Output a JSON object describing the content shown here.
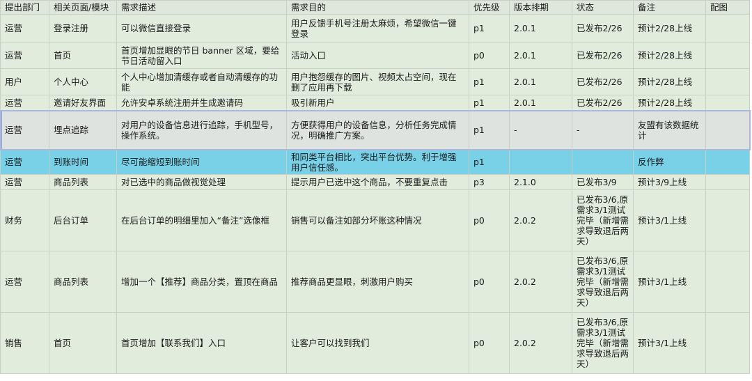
{
  "columns": [
    "提出部门",
    "相关页面/模块",
    "需求描述",
    "需求目的",
    "优先级",
    "版本排期",
    "状态",
    "备注",
    "配图"
  ],
  "rows": [
    {
      "dept": "运营",
      "page": "登录注册",
      "desc": "可以微信直接登录",
      "purpose": "用户反馈手机号注册太麻烦，希望微信一键登录",
      "priority": "p1",
      "version": "2.0.1",
      "status": "已发布2/26",
      "note": "预计2/28上线",
      "image": ""
    },
    {
      "dept": "运营",
      "page": "首页",
      "desc": "首页增加显眼的节日 banner 区域，要给节日活动留入口",
      "purpose": "活动入口",
      "priority": "p0",
      "version": "2.0.1",
      "status": "已发布2/26",
      "note": "预计2/28上线",
      "image": ""
    },
    {
      "dept": "用户",
      "page": "个人中心",
      "desc": " 个人中心增加清缓存或者自动清缓存的功能",
      "purpose": "用户抱怨缓存的图片、视频太占空间，现在删了应用再下载",
      "priority": "p1",
      "version": "2.0.1",
      "status": "已发布2/26",
      "note": "预计2/28上线",
      "image": ""
    },
    {
      "dept": "运营",
      "page": "邀请好友界面",
      "desc": "允许安卓系统注册并生成邀请码",
      "purpose": "吸引新用户",
      "priority": "p1",
      "version": "2.0.1",
      "status": "已发布2/26",
      "note": "预计2/28上线",
      "image": ""
    },
    {
      "dept": "运营",
      "page": "埋点追踪",
      "desc": "对用户的设备信息进行追踪，手机型号，操作系统。",
      "purpose": "方便获得用户的设备信息，分析任务完成情况，明确推广方案。",
      "priority": "p1",
      "version": "-",
      "status": "-",
      "note": "友盟有该数据统计",
      "image": ""
    },
    {
      "dept": "运营",
      "page": "到账时间",
      "desc": "尽可能缩短到账时间",
      "purpose": "和同类平台相比，突出平台优势。利于增强用户信任感。",
      "priority": "p1",
      "version": "",
      "status": "",
      "note": "反作弊",
      "image": ""
    },
    {
      "dept": "运营",
      "page": "商品列表",
      "desc": "对已选中的商品做视觉处理",
      "purpose": "提示用户已选中这个商品，不要重复点击",
      "priority": "p3",
      "version": "2.1.0",
      "status": "已发布3/9",
      "note": "预计3/9上线",
      "image": ""
    },
    {
      "dept": "财务",
      "page": "后台订单",
      "desc": "在后台订单的明细里加入“备注”选像框",
      "purpose": "销售可以备注如部分坏账这种情况",
      "priority": "p0",
      "version": "2.0.2",
      "status": "已发布3/6,原需求3/1测试完毕（新增需求导致退后两天）",
      "note": "预计3/1上线",
      "image": ""
    },
    {
      "dept": "运营",
      "page": "商品列表",
      "desc": "增加一个【推荐】商品分类，置顶在商品",
      "purpose": "推荐商品更显眼，刺激用户购买",
      "priority": "p0",
      "version": "2.0.2",
      "status": "已发布3/6,原需求3/1测试完毕（新增需求导致退后两天）",
      "note": "预计3/1上线",
      "image": ""
    },
    {
      "dept": "销售",
      "page": "首页",
      "desc": "首页增加【联系我们】入口",
      "purpose": "让客户可以找到我们",
      "priority": "p0",
      "version": "2.0.2",
      "status": "已发布3/6,原需求3/1测试完毕（新增需求导致退后两天）",
      "note": "预计3/1上线",
      "image": ""
    }
  ]
}
